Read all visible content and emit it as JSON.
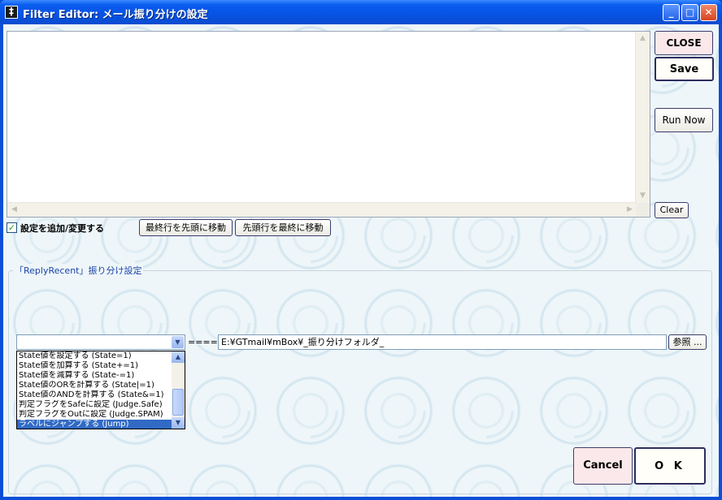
{
  "window": {
    "title": "Filter Editor: メール振り分けの設定",
    "minimize": "_",
    "maximize": "□",
    "close": "✕"
  },
  "buttons": {
    "close": "CLOSE",
    "save": "Save",
    "run_now": "Run Now",
    "clear": "Clear",
    "move_last_to_first": "最終行を先頭に移動",
    "move_first_to_last": "先頭行を最終に移動",
    "browse": "参照 ...",
    "cancel": "Cancel",
    "ok": "O K"
  },
  "checkbox": {
    "label": "設定を追加/変更する",
    "checked": true
  },
  "group": {
    "title": "「ReplyRecent」振り分け設定"
  },
  "action": {
    "combo_value": "",
    "arrow": "====>",
    "path": "E:¥GTmail¥mBox¥_振り分けフォルダ_"
  },
  "action_list": {
    "items": [
      "State値を設定する (State=1)",
      "State値を加算する (State+=1)",
      "State値を減算する (State-=1)",
      "State値のORを計算する (State|=1)",
      "State値のANDを計算する (State&=1)",
      "判定フラグをSafeに設定 (Judge.Safe)",
      "判定フラグをOutに設定 (Judge.SPAM)",
      "ラベルにジャンプする (Jump)"
    ],
    "selected_index": 7
  }
}
